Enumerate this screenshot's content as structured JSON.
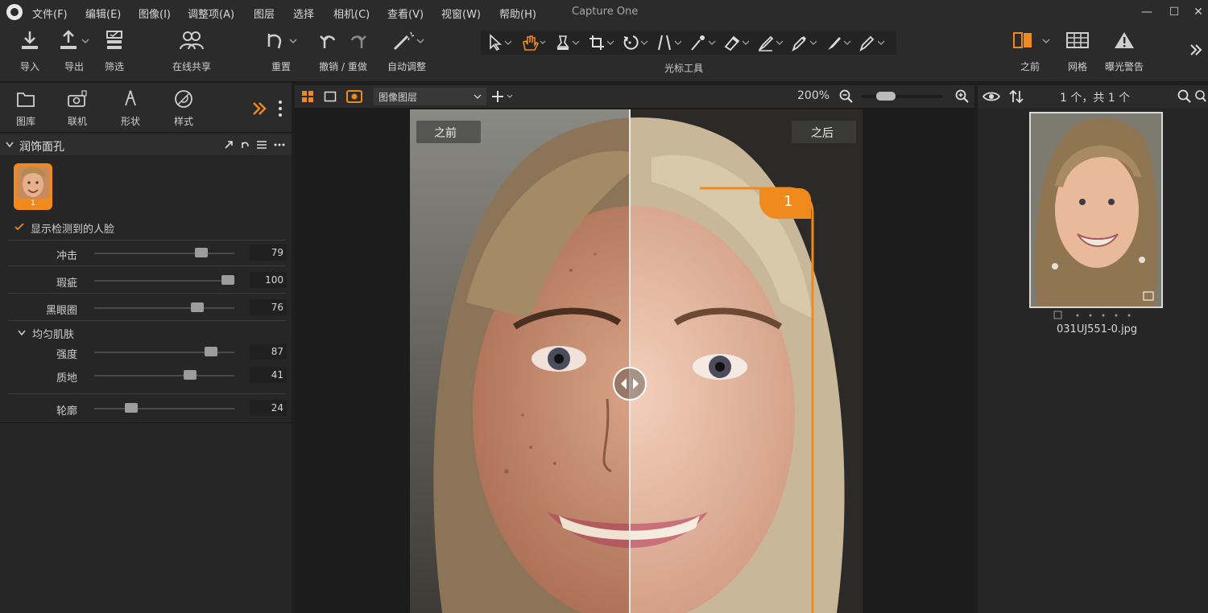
{
  "window": {
    "title": "Capture One"
  },
  "menu": [
    "文件(F)",
    "编辑(E)",
    "图像(I)",
    "调整项(A)",
    "图层",
    "选择",
    "相机(C)",
    "查看(V)",
    "视窗(W)",
    "帮助(H)"
  ],
  "window_controls": {
    "minimize": "—",
    "maximize": "☐",
    "close": "✕"
  },
  "toolbar": {
    "import": "导入",
    "export": "导出",
    "filter": "筛选",
    "share": "在线共享",
    "reset": "重置",
    "undo_redo": "撤销 / 重做",
    "auto_adjust": "自动调整",
    "cursor_tools": "光标工具",
    "before": "之前",
    "grid": "网格",
    "exposure_warning": "曝光警告"
  },
  "left_tabs": [
    "图库",
    "联机",
    "形状",
    "样式"
  ],
  "panel": {
    "title": "润饰面孔",
    "face_badge": "1",
    "show_faces_label": "显示检测到的人脸",
    "sliders": [
      {
        "label": "冲击",
        "value": "79",
        "fraction": 0.79
      },
      {
        "label": "瑕疵",
        "value": "100",
        "fraction": 1.0
      },
      {
        "label": "黑眼圈",
        "value": "76",
        "fraction": 0.76
      }
    ],
    "even_skin_label": "均匀肌肤",
    "even_skin_sliders": [
      {
        "label": "强度",
        "value": "87",
        "fraction": 0.87
      },
      {
        "label": "质地",
        "value": "41",
        "fraction": 0.7
      }
    ],
    "contour": {
      "label": "轮廓",
      "value": "24",
      "fraction": 0.24
    }
  },
  "viewer": {
    "layer_select": "图像图层",
    "zoom": "200%",
    "before_label": "之前",
    "after_label": "之后",
    "face_marker": "1"
  },
  "browser": {
    "count": "1 个，共 1 个",
    "filename": "031UJ551-0.jpg"
  },
  "colors": {
    "accent": "#f08a1c",
    "panel": "#262626",
    "toolbar": "#2b2b2b"
  }
}
